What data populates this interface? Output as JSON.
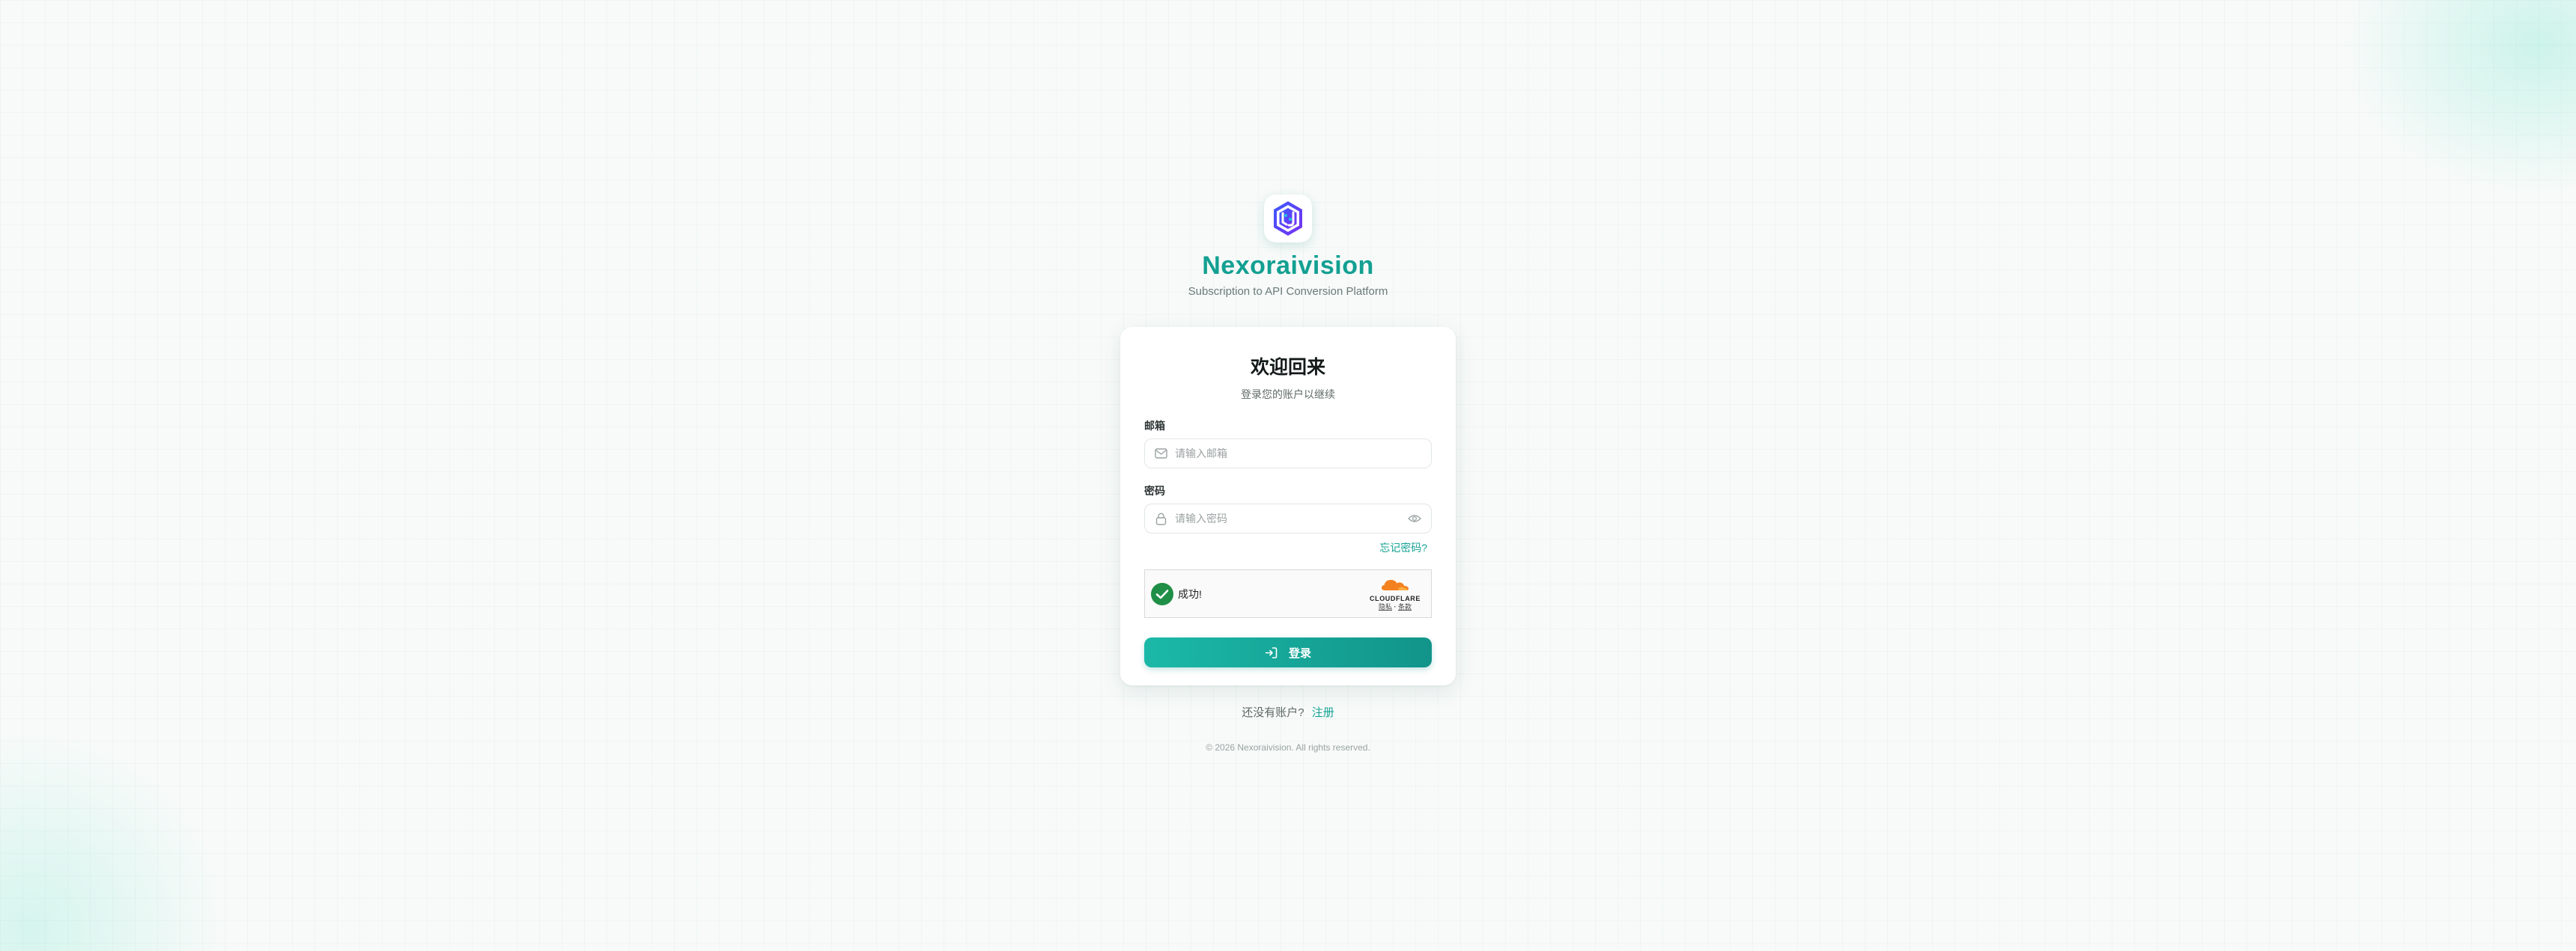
{
  "brand": {
    "name": "Nexoraivision",
    "tagline": "Subscription to API Conversion Platform",
    "logo_icon": "hexagon-logo-icon"
  },
  "login_card": {
    "title": "欢迎回来",
    "subtitle": "登录您的账户以继续",
    "email": {
      "label": "邮箱",
      "placeholder": "请输入邮箱",
      "value": "",
      "icon": "mail-icon"
    },
    "password": {
      "label": "密码",
      "placeholder": "请输入密码",
      "value": "",
      "icon": "lock-icon",
      "toggle_icon": "eye-icon"
    },
    "forgot_password": "忘记密码?",
    "captcha": {
      "status_text": "成功!",
      "provider": "CLOUDFLARE",
      "privacy_label": "隐私",
      "separator": "·",
      "terms_label": "条款",
      "accent_color": "#f48120",
      "success_color": "#1f8f47"
    },
    "login_button": "登录"
  },
  "footer": {
    "no_account_text": "还没有账户?",
    "register_link": "注册",
    "copyright": "© 2026 Nexoraivision. All rights reserved."
  },
  "colors": {
    "accent": "#13a092",
    "button_start": "#1bb9a8",
    "button_end": "#12948a"
  }
}
